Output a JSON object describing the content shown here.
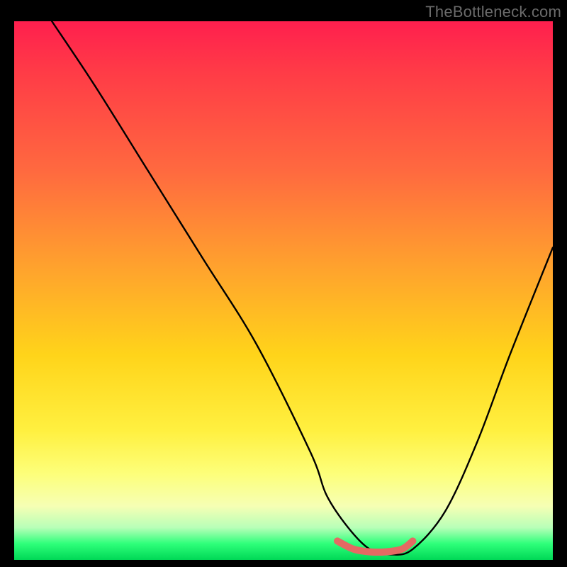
{
  "watermark": "TheBottleneck.com",
  "chart_data": {
    "type": "line",
    "title": "",
    "xlabel": "",
    "ylabel": "",
    "xlim": [
      0,
      100
    ],
    "ylim": [
      0,
      100
    ],
    "grid": false,
    "legend": false,
    "series": [
      {
        "name": "bottleneck-curve",
        "color": "#000000",
        "x": [
          7,
          15,
          25,
          35,
          45,
          55,
          58,
          62,
          66,
          70,
          74,
          80,
          86,
          92,
          100
        ],
        "y": [
          100,
          88,
          72,
          56,
          40,
          20,
          12,
          6,
          2,
          1,
          2,
          9,
          22,
          38,
          58
        ]
      },
      {
        "name": "optimal-range",
        "color": "#e46a63",
        "x": [
          60,
          63,
          66,
          69,
          72,
          74
        ],
        "y": [
          3.5,
          2.0,
          1.5,
          1.5,
          2.0,
          3.5
        ]
      }
    ],
    "annotations": []
  }
}
